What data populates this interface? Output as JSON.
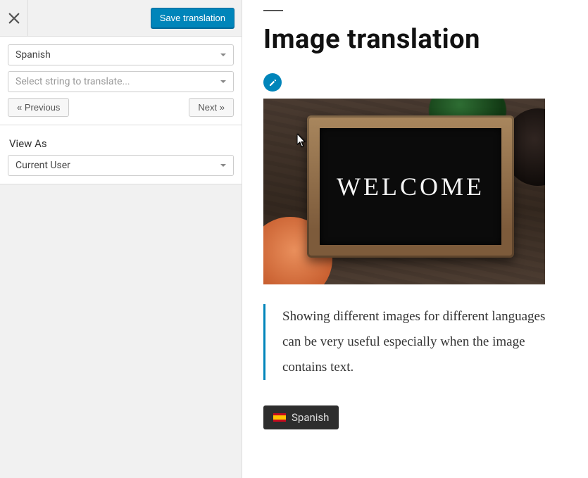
{
  "toolbar": {
    "save_label": "Save translation"
  },
  "sidebar": {
    "language_select": "Spanish",
    "string_select_placeholder": "Select string to translate...",
    "prev_label": "« Previous",
    "next_label": "Next »",
    "view_as_label": "View As",
    "view_as_value": "Current User"
  },
  "page": {
    "title": "Image translation",
    "hero_text": "WELCOME",
    "blockquote": "Showing different images for different languages can be very useful especially when the image contains text.",
    "lang_switch_label": "Spanish"
  }
}
